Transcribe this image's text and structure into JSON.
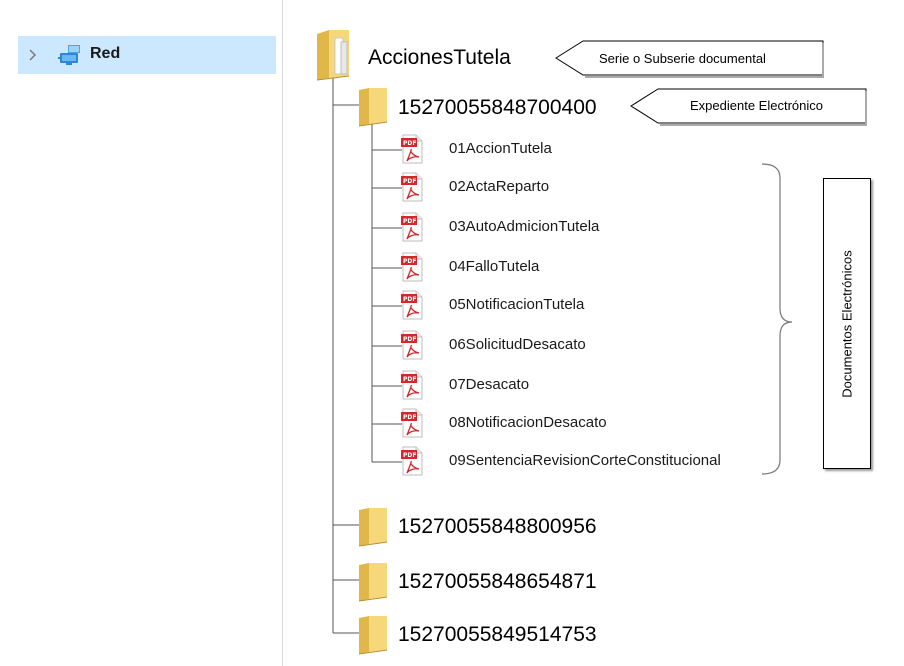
{
  "navigation": {
    "items": [
      {
        "label": "Red",
        "icon": "network-icon",
        "selected": true
      }
    ]
  },
  "tree": {
    "root": {
      "label": "AccionesTutela",
      "icon": "folder-icon"
    },
    "expanded_folder": {
      "label": "15270055848700400",
      "icon": "folder-icon"
    },
    "documents": [
      {
        "label": "01AccionTutela",
        "icon": "pdf-icon"
      },
      {
        "label": "02ActaReparto",
        "icon": "pdf-icon"
      },
      {
        "label": "03AutoAdmicionTutela",
        "icon": "pdf-icon"
      },
      {
        "label": "04FalloTutela",
        "icon": "pdf-icon"
      },
      {
        "label": "05NotificacionTutela",
        "icon": "pdf-icon"
      },
      {
        "label": "06SolicitudDesacato",
        "icon": "pdf-icon"
      },
      {
        "label": "07Desacato",
        "icon": "pdf-icon"
      },
      {
        "label": "08NotificacionDesacato",
        "icon": "pdf-icon"
      },
      {
        "label": "09SentenciaRevisionCorteConstitucional",
        "icon": "pdf-icon"
      }
    ],
    "other_folders": [
      {
        "label": "15270055848800956",
        "icon": "folder-icon"
      },
      {
        "label": "15270055848654871",
        "icon": "folder-icon"
      },
      {
        "label": "15270055849514753",
        "icon": "folder-icon"
      }
    ]
  },
  "annotations": {
    "serie": "Serie o Subserie documental",
    "expediente": "Expediente Electrónico",
    "documentos": "Documentos Electrónicos"
  },
  "colors": {
    "selection": "#cce8ff",
    "folder_body": "#f6d77a",
    "folder_dark": "#e0b84a",
    "pdf_red": "#d0282c",
    "lines": "#555555"
  }
}
